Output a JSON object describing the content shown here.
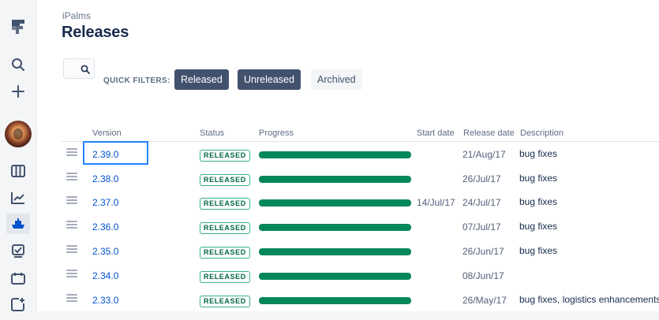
{
  "breadcrumb": "iPalms",
  "page_title": "Releases",
  "sidebar": {
    "items": [
      {
        "name": "jira-logo-icon"
      },
      {
        "name": "search-icon"
      },
      {
        "name": "create-icon"
      },
      {
        "name": "avatar"
      },
      {
        "name": "board-icon"
      },
      {
        "name": "reports-icon"
      },
      {
        "name": "releases-icon",
        "active": true
      },
      {
        "name": "issues-icon"
      },
      {
        "name": "components-icon"
      },
      {
        "name": "add-item-icon"
      }
    ]
  },
  "filters": {
    "label": "QUICK FILTERS:",
    "buttons": [
      {
        "label": "Released",
        "selected": true
      },
      {
        "label": "Unreleased",
        "selected": true
      },
      {
        "label": "Archived",
        "selected": false
      }
    ]
  },
  "table": {
    "columns": [
      "Version",
      "Status",
      "Progress",
      "Start date",
      "Release date",
      "Description"
    ],
    "rows": [
      {
        "version": "2.39.0",
        "status": "RELEASED",
        "progress": 1.0,
        "start_date": "",
        "release_date": "21/Aug/17",
        "description": "bug fixes"
      },
      {
        "version": "2.38.0",
        "status": "RELEASED",
        "progress": 1.0,
        "start_date": "",
        "release_date": "26/Jul/17",
        "description": "bug fixes"
      },
      {
        "version": "2.37.0",
        "status": "RELEASED",
        "progress": 1.0,
        "start_date": "14/Jul/17",
        "release_date": "24/Jul/17",
        "description": "bug fixes"
      },
      {
        "version": "2.36.0",
        "status": "RELEASED",
        "progress": 1.0,
        "start_date": "",
        "release_date": "07/Jul/17",
        "description": "bug fixes"
      },
      {
        "version": "2.35.0",
        "status": "RELEASED",
        "progress": 1.0,
        "start_date": "",
        "release_date": "26/Jun/17",
        "description": "bug fixes"
      },
      {
        "version": "2.34.0",
        "status": "RELEASED",
        "progress": 1.0,
        "start_date": "",
        "release_date": "08/Jun/17",
        "description": ""
      },
      {
        "version": "2.33.0",
        "status": "RELEASED",
        "progress": 1.0,
        "start_date": "",
        "release_date": "26/May/17",
        "description": "bug fixes, logistics enhancements"
      }
    ]
  },
  "colors": {
    "accent": "#0052cc",
    "progress_done": "#00875a",
    "status_border": "#36b37e",
    "filter_selected": "#42526e",
    "focus": "#2684ff"
  }
}
